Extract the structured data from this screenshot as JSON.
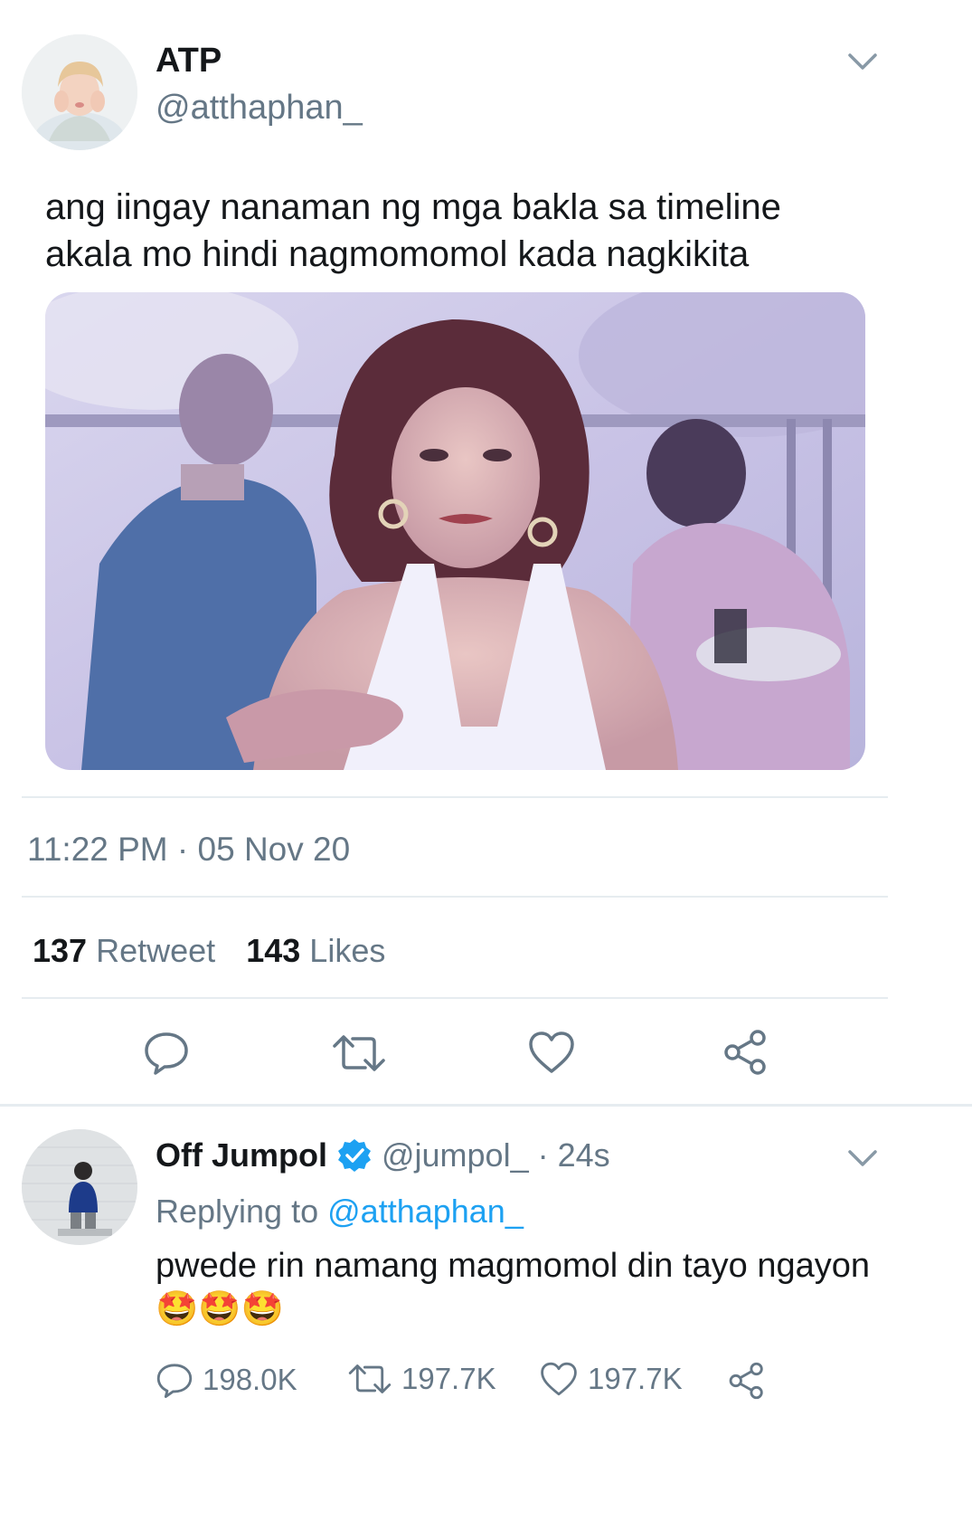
{
  "tweet": {
    "author_name": "ATP",
    "author_handle": "@atthaphan_",
    "text_line1": "ang iingay nanaman ng mga bakla sa timeline",
    "text_line2": "akala mo hindi nagmomomol kada nagkikita",
    "timestamp": "11:22 PM · 05 Nov 20",
    "retweet_count": "137",
    "retweet_label": "Retweet",
    "like_count": "143",
    "like_label": "Likes"
  },
  "reply": {
    "author_name": "Off Jumpol",
    "author_handle": "@jumpol_",
    "age": "· 24s",
    "replying_prefix": "Replying to",
    "replying_handle": "@atthaphan_",
    "text": "pwede rin namang magmomol din tayo ngayon",
    "emoji": "🤩🤩🤩",
    "reply_count": "198.0K",
    "retweet_count": "197.7K",
    "like_count": "197.7K"
  },
  "colors": {
    "accent": "#1da1f2",
    "muted": "#657786",
    "divider": "#e6ecf0"
  },
  "icons": [
    "chevron-down-icon",
    "reply-icon",
    "retweet-icon",
    "like-icon",
    "share-icon",
    "verified-badge-icon"
  ]
}
